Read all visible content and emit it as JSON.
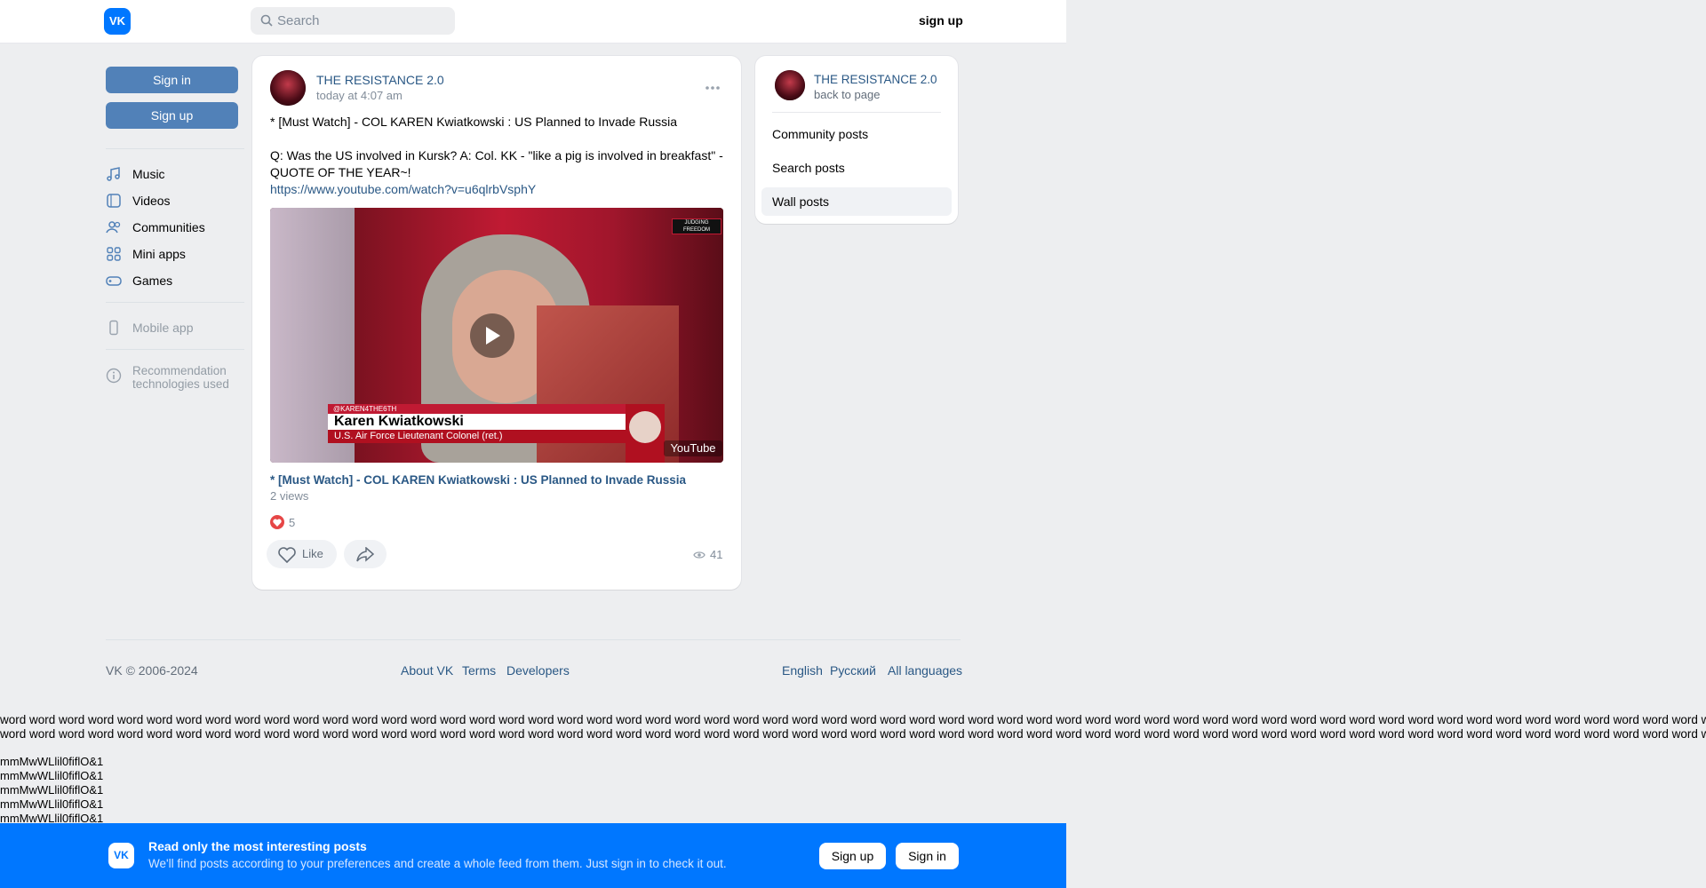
{
  "header": {
    "logo": "VK",
    "search_placeholder": "Search",
    "sign_up": "sign up"
  },
  "sidebar": {
    "sign_in": "Sign in",
    "sign_up": "Sign up",
    "items": [
      {
        "label": "Music",
        "icon": "music-icon"
      },
      {
        "label": "Videos",
        "icon": "video-icon"
      },
      {
        "label": "Communities",
        "icon": "users-icon"
      },
      {
        "label": "Mini apps",
        "icon": "apps-icon"
      },
      {
        "label": "Games",
        "icon": "gamepad-icon"
      }
    ],
    "mobile_app": "Mobile app",
    "recommendation": "Recommendation technologies used"
  },
  "post": {
    "author": "THE RESISTANCE 2.0",
    "time": "today at 4:07 am",
    "text_line1": "* [Must Watch] - COL KAREN Kwiatkowski : US Planned to Invade Russia",
    "text_line2": "Q: Was the US involved in Kursk? A: Col. KK - \"like a pig is involved in breakfast\" -",
    "text_line3": "QUOTE OF THE YEAR~!",
    "link": "https://www.youtube.com/watch?v=u6qlrbVsphY",
    "video": {
      "handle": "@KAREN4THE6TH",
      "name": "Karen Kwiatkowski",
      "subtitle": "U.S. Air Force Lieutenant Colonel (ret.)",
      "source": "YouTube",
      "badge": "JUDGING FREEDOM"
    },
    "video_title": "* [Must Watch] - COL KAREN Kwiatkowski : US Planned to Invade Russia",
    "video_views": "2 views",
    "reactions": "5",
    "like_label": "Like",
    "views": "41"
  },
  "right_panel": {
    "group": "THE RESISTANCE 2.0",
    "back": "back to page",
    "items": [
      "Community posts",
      "Search posts",
      "Wall posts"
    ]
  },
  "footer": {
    "copyright": "VK © 2006-2024",
    "about": "About VK",
    "terms": "Terms",
    "developers": "Developers",
    "english": "English",
    "russian": "Русский",
    "all_languages": "All languages"
  },
  "filler": {
    "word_line": "word word word word word word word word word word word word word word word word word word word word word word word word word word word word word word word word word word word word word word word word word word word word word word word word word word word word word word word word word word word word word",
    "mm_lines": [
      "mmMwWLlil0fiflO&1",
      "mmMwWLlil0fiflO&1",
      "mmMwWLlil0fiflO&1",
      "mmMwWLlil0fiflO&1",
      "mmMwWLlil0fiflO&1"
    ]
  },
  "banner": {
    "title": "Read only the most interesting posts",
    "subtitle": "We'll find posts according to your preferences and create a whole feed from them. Just sign in to check it out.",
    "sign_up": "Sign up",
    "sign_in": "Sign in"
  }
}
